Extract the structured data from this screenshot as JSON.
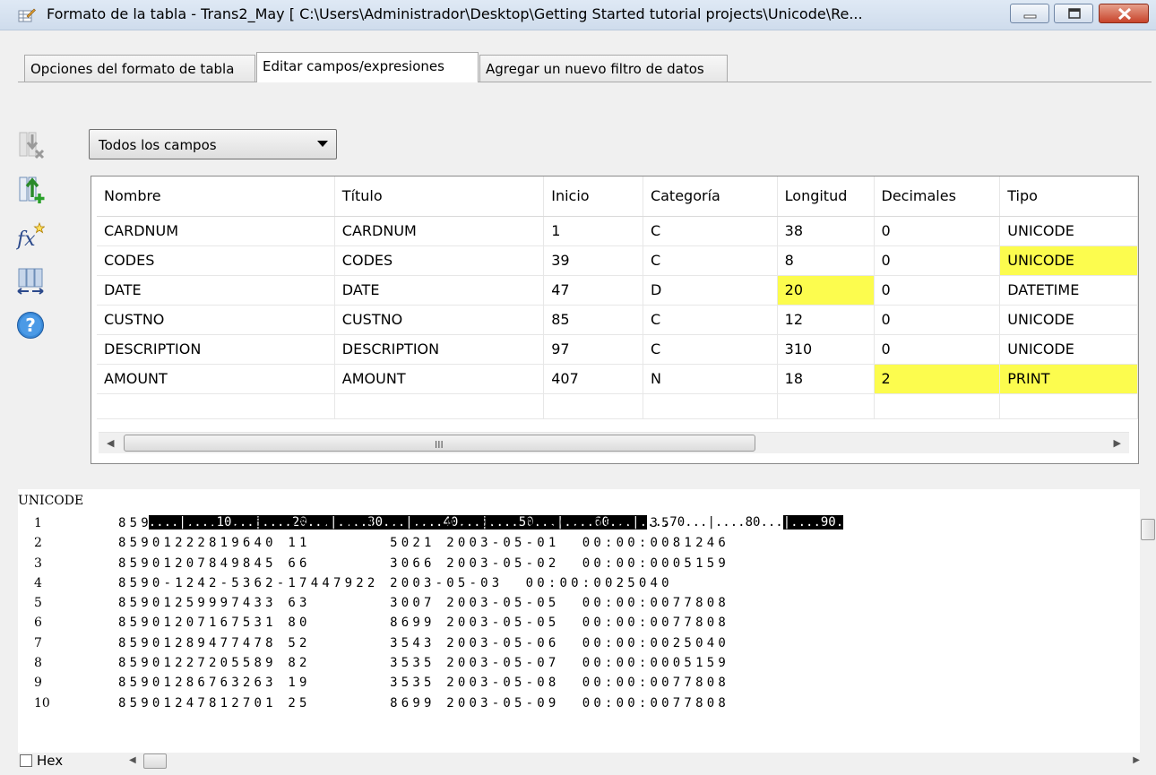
{
  "window": {
    "title": "Formato de la tabla - Trans2_May [ C:\\Users\\Administrador\\Desktop\\Getting Started tutorial projects\\Unicode\\Re...",
    "icon": "table-edit-icon"
  },
  "tabs": [
    {
      "label": "Opciones del formato de tabla",
      "active": false
    },
    {
      "label": "Editar campos/expresiones",
      "active": true
    },
    {
      "label": "Agregar un nuevo filtro de datos",
      "active": false
    }
  ],
  "toolbar": {
    "icons": [
      "remove-field-icon",
      "add-field-icon",
      "fx-expression-icon",
      "move-columns-icon",
      "help-icon"
    ]
  },
  "filter": {
    "selected": "Todos los campos"
  },
  "grid": {
    "columns": [
      "Nombre",
      "Título",
      "Inicio",
      "Categoría",
      "Longitud",
      "Decimales",
      "Tipo"
    ],
    "rows": [
      {
        "nombre": "CARDNUM",
        "titulo": "CARDNUM",
        "inicio": "1",
        "categoria": "C",
        "longitud": "38",
        "decimales": "0",
        "tipo": "UNICODE"
      },
      {
        "nombre": "CODES",
        "titulo": "CODES",
        "inicio": "39",
        "categoria": "C",
        "longitud": "8",
        "decimales": "0",
        "tipo": "UNICODE"
      },
      {
        "nombre": "DATE",
        "titulo": "DATE",
        "inicio": "47",
        "categoria": "D",
        "longitud": "20",
        "decimales": "0",
        "tipo": "DATETIME"
      },
      {
        "nombre": "CUSTNO",
        "titulo": "CUSTNO",
        "inicio": "85",
        "categoria": "C",
        "longitud": "12",
        "decimales": "0",
        "tipo": "UNICODE"
      },
      {
        "nombre": "DESCRIPTION",
        "titulo": "DESCRIPTION",
        "inicio": "97",
        "categoria": "C",
        "longitud": "310",
        "decimales": "0",
        "tipo": "UNICODE"
      },
      {
        "nombre": "AMOUNT",
        "titulo": "AMOUNT",
        "inicio": "407",
        "categoria": "N",
        "longitud": "18",
        "decimales": "2",
        "tipo": "PRINT"
      }
    ],
    "scroll_grip": "III",
    "highlight_color": "#fcfc4e"
  },
  "preview": {
    "label": "UNICODE",
    "ruler_dark_1": "....|....10...|....20...|....30...|....40...|....50...|....60...|.",
    "ruler_light": "...70...|....80...",
    "ruler_dark_2": "|....90.",
    "rows": [
      {
        "num": "1",
        "text": "8590-1224-9766-38072741 2003-05-04  00:00:0096235"
      },
      {
        "num": "2",
        "text": "85901222819640 11       5021 2003-05-01  00:00:0081246"
      },
      {
        "num": "3",
        "text": "85901207849845 66       3066 2003-05-02  00:00:0005159"
      },
      {
        "num": "4",
        "text": "8590-1242-5362-17447922 2003-05-03  00:00:0025040"
      },
      {
        "num": "5",
        "text": "85901259997433 63       3007 2003-05-05  00:00:0077808"
      },
      {
        "num": "6",
        "text": "85901207167531 80       8699 2003-05-05  00:00:0077808"
      },
      {
        "num": "7",
        "text": "85901289477478 52       3543 2003-05-06  00:00:0025040"
      },
      {
        "num": "8",
        "text": "85901227205589 82       3535 2003-05-07  00:00:0005159"
      },
      {
        "num": "9",
        "text": "85901286763263 19       3535 2003-05-08  00:00:0077808"
      },
      {
        "num": "10",
        "text": "85901247812701 25       8699 2003-05-09  00:00:0077808"
      }
    ]
  },
  "hex": {
    "label": "Hex",
    "checked": false
  }
}
